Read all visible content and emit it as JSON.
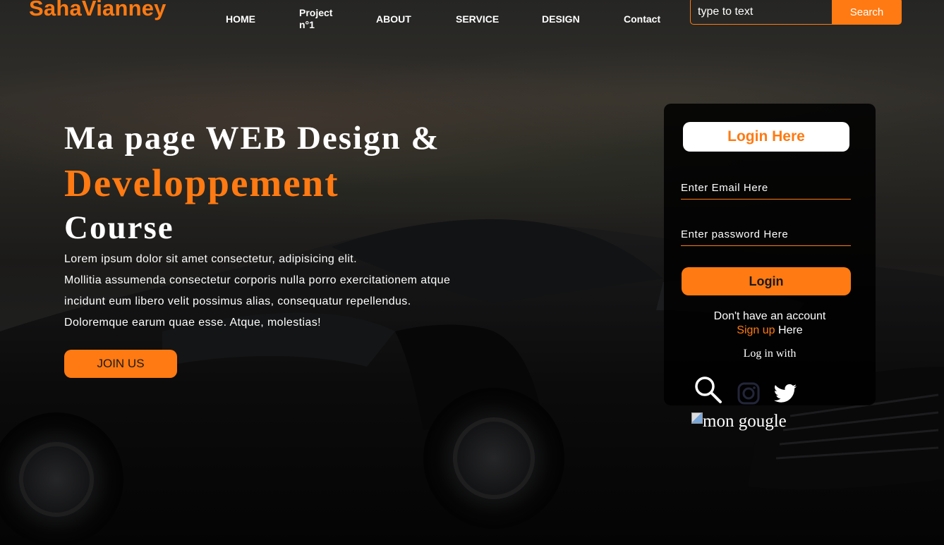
{
  "header": {
    "logo": "SahaVianney",
    "nav": [
      "HOME",
      "Project n°1",
      "ABOUT",
      "SERVICE",
      "DESIGN",
      "Contact"
    ],
    "search": {
      "placeholder": "type to text",
      "button": "Search"
    }
  },
  "hero": {
    "title_line1": "Ma page WEB Design &",
    "title_line2": "Developpement",
    "title_line3": "Course",
    "paragraph": [
      "Lorem ipsum dolor sit amet consectetur, adipisicing elit.",
      "Mollitia assumenda consectetur corporis nulla porro exercitationem atque",
      "incidunt eum libero velit possimus alias, consequatur repellendus.",
      "Doloremque earum quae esse. Atque, molestias!"
    ],
    "join_button": "JOIN US"
  },
  "login": {
    "title": "Login Here",
    "email_placeholder": "Enter Email Here",
    "password_placeholder": "Enter password Here",
    "button": "Login",
    "no_account": "Don't have an account",
    "signup_link": "Sign up",
    "signup_suffix": " Here",
    "log_in_with": "Log in with",
    "social_icons": [
      "search-icon",
      "instagram-icon",
      "twitter-icon"
    ],
    "broken_image_alt": "mon gougle"
  },
  "colors": {
    "accent": "#ff7a12",
    "panel": "#000000",
    "text": "#ffffff"
  }
}
